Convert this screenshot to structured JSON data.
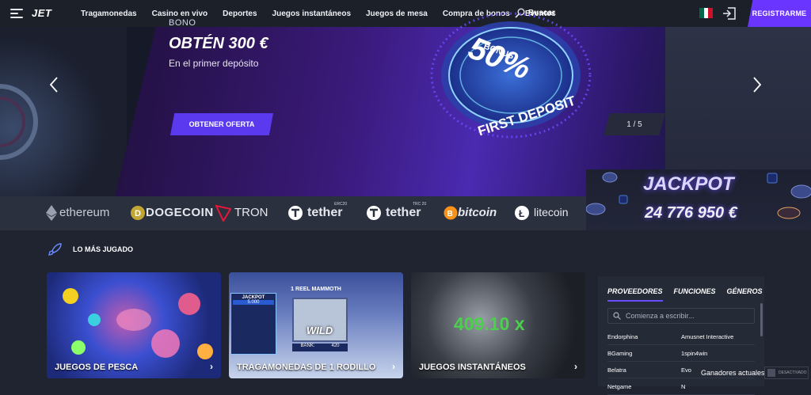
{
  "header": {
    "logo": "JET",
    "nav": [
      "Tragamonedas",
      "Casino en vivo",
      "Deportes",
      "Juegos instantáneos",
      "Juegos de mesa",
      "Compra de bonos",
      "Eventos"
    ],
    "search_label": "Buscar",
    "register_label": "REGISTRARME",
    "flag_colors": [
      "#006847",
      "#ffffff",
      "#ce1126"
    ]
  },
  "hero": {
    "eyebrow": "BONO",
    "headline": "OBTÉN 300 €",
    "subtitle": "En el primer depósito",
    "cta": "OBTENER OFERTA",
    "counter": "1 / 5",
    "badge_small": "BONUS",
    "badge_big": "50%",
    "badge_ring": "FIRST DEPOSIT"
  },
  "crypto": [
    "ethereum",
    "DOGECOIN",
    "TRON",
    "tether",
    "tether",
    "bitcoin",
    "litecoin"
  ],
  "crypto_tags": [
    "ERC20",
    "TRC 20"
  ],
  "jackpot": {
    "title": "JACKPOT",
    "value": "24 776 950 €"
  },
  "section": {
    "title": "LO MÁS JUGADO"
  },
  "cards": [
    {
      "label": "JUEGOS DE PESCA"
    },
    {
      "label": "TRAGAMONEDAS DE 1 RODILLO",
      "game_title": "1 REEL MAMMOTH",
      "jackpot": "JACKPOT",
      "jackpot_val": "5.000",
      "bank_label": "BANK:",
      "bank_val": "420",
      "wild": "WILD"
    },
    {
      "label": "JUEGOS INSTANTÁNEOS",
      "multiplier": "409.10 x"
    }
  ],
  "providers": {
    "tabs": [
      "PROVEEDORES",
      "FUNCIONES",
      "GÉNEROS"
    ],
    "search_placeholder": "Comienza a escribir...",
    "rows": [
      [
        "Endorphina",
        "Amusnet Interactive"
      ],
      [
        "BGaming",
        "1spin4win"
      ],
      [
        "Belatra",
        "Evo"
      ],
      [
        "Netgame",
        "N"
      ]
    ]
  },
  "winners": {
    "label": "Ganadores actuales",
    "toggle": "DESACTIVADO"
  }
}
